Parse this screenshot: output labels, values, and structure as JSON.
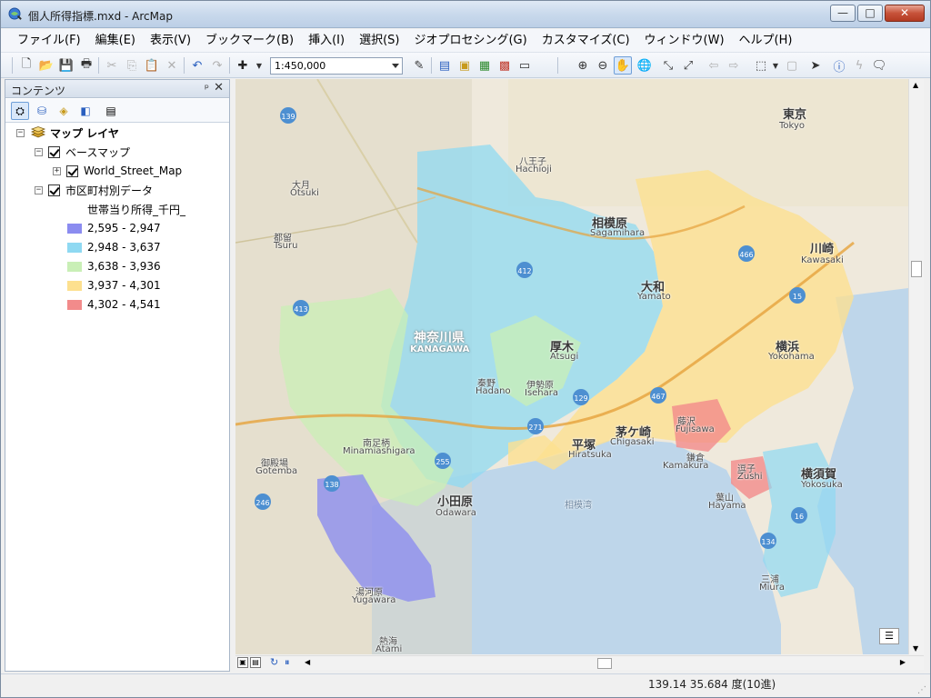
{
  "window": {
    "title": "個人所得指標.mxd - ArcMap",
    "minimize_glyph": "—",
    "maximize_glyph": "□",
    "close_glyph": "✕"
  },
  "menu": [
    "ファイル(F)",
    "編集(E)",
    "表示(V)",
    "ブックマーク(B)",
    "挿入(I)",
    "選択(S)",
    "ジオプロセシング(G)",
    "カスタマイズ(C)",
    "ウィンドウ(W)",
    "ヘルプ(H)"
  ],
  "toolbar": {
    "scale": "1:450,000"
  },
  "toc": {
    "title": "コンテンツ",
    "pin_glyph": "ᵖ",
    "close_glyph": "✕",
    "map_layers": "マップ レイヤ",
    "basemap_group": "ベースマップ",
    "basemap_layer": "World_Street_Map",
    "data_layer": "市区町村別データ",
    "field_name": "世帯当り所得_千円_",
    "legend": [
      {
        "label": "2,595 - 2,947",
        "color": "#8b8cf0"
      },
      {
        "label": "2,948 - 3,637",
        "color": "#8fd9f2"
      },
      {
        "label": "3,638 - 3,936",
        "color": "#c9efb6"
      },
      {
        "label": "3,937 - 4,301",
        "color": "#fde08f"
      },
      {
        "label": "4,302 - 4,541",
        "color": "#f28b8b"
      }
    ]
  },
  "map": {
    "labels": [
      {
        "t": "東京",
        "cls": "big"
      },
      {
        "t": "Tokyo",
        "cls": ""
      },
      {
        "t": "八王子",
        "cls": ""
      },
      {
        "t": "Hachioji",
        "cls": ""
      },
      {
        "t": "相模原",
        "cls": "big"
      },
      {
        "t": "Sagamihara",
        "cls": ""
      },
      {
        "t": "川崎",
        "cls": "big"
      },
      {
        "t": "Kawasaki",
        "cls": ""
      },
      {
        "t": "大和",
        "cls": "big"
      },
      {
        "t": "Yamato",
        "cls": ""
      },
      {
        "t": "横浜",
        "cls": "big"
      },
      {
        "t": "Yokohama",
        "cls": ""
      },
      {
        "t": "厚木",
        "cls": "big"
      },
      {
        "t": "Atsugi",
        "cls": ""
      },
      {
        "t": "神奈川県",
        "cls": "pref"
      },
      {
        "t": "KANAGAWA",
        "cls": "pref"
      },
      {
        "t": "茅ケ崎",
        "cls": "big"
      },
      {
        "t": "Chigasaki",
        "cls": ""
      },
      {
        "t": "平塚",
        "cls": "big"
      },
      {
        "t": "Hiratsuka",
        "cls": ""
      },
      {
        "t": "藤沢",
        "cls": ""
      },
      {
        "t": "Fujisawa",
        "cls": ""
      },
      {
        "t": "鎌倉",
        "cls": ""
      },
      {
        "t": "Kamakura",
        "cls": ""
      },
      {
        "t": "横須賀",
        "cls": "big"
      },
      {
        "t": "Yokosuka",
        "cls": ""
      },
      {
        "t": "小田原",
        "cls": "big"
      },
      {
        "t": "Odawara",
        "cls": ""
      },
      {
        "t": "相模湾",
        "cls": "sea"
      },
      {
        "t": "三浦",
        "cls": ""
      },
      {
        "t": "Miura",
        "cls": ""
      },
      {
        "t": "湯河原",
        "cls": ""
      },
      {
        "t": "Yugawara",
        "cls": ""
      },
      {
        "t": "秦野",
        "cls": ""
      },
      {
        "t": "Hadano",
        "cls": ""
      },
      {
        "t": "伊勢原",
        "cls": ""
      },
      {
        "t": "Isehara",
        "cls": ""
      },
      {
        "t": "南足柄",
        "cls": ""
      },
      {
        "t": "Minamiashigara",
        "cls": ""
      },
      {
        "t": "御殿場",
        "cls": ""
      },
      {
        "t": "Gotemba",
        "cls": ""
      },
      {
        "t": "逗子",
        "cls": ""
      },
      {
        "t": "Zushi",
        "cls": ""
      },
      {
        "t": "葉山",
        "cls": ""
      },
      {
        "t": "Hayama",
        "cls": ""
      },
      {
        "t": "熱海",
        "cls": ""
      },
      {
        "t": "Atami",
        "cls": ""
      },
      {
        "t": "大月",
        "cls": ""
      },
      {
        "t": "Otsuki",
        "cls": ""
      },
      {
        "t": "都留",
        "cls": ""
      },
      {
        "t": "Tsuru",
        "cls": ""
      }
    ]
  },
  "status": {
    "coords": "139.14  35.684 度(10進)"
  }
}
